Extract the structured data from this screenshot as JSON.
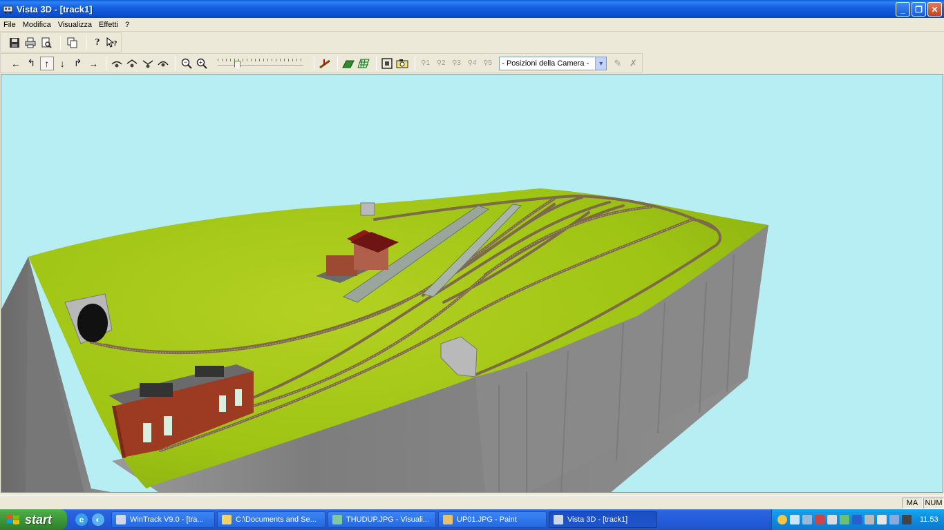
{
  "window": {
    "title": "Vista 3D - [track1]",
    "controls": {
      "minimize": "_",
      "maximize": "❐",
      "close": "✕"
    }
  },
  "menu": [
    "File",
    "Modifica",
    "Visualizza",
    "Effetti",
    "?"
  ],
  "toolbar1": {
    "icons": [
      "save-icon",
      "print-icon",
      "print-preview-icon",
      "copy-icon",
      "help-icon",
      "context-help-icon"
    ]
  },
  "toolbar2": {
    "nav_glyphs": {
      "left": "←",
      "turn_left": "↰",
      "up": "↑",
      "down": "↓",
      "turn_right": "↱",
      "right": "→"
    },
    "zoom_glyphs": {
      "out": "−",
      "in": "+"
    },
    "camera_labels": [
      "1",
      "2",
      "3",
      "4",
      "5"
    ],
    "camera_select_value": "- Posizioni della Camera -",
    "zoom_slider_value": 0.2
  },
  "status": {
    "ma": "MA",
    "num": "NUM"
  },
  "taskbar": {
    "start_label": "start",
    "tasks": [
      {
        "label": "WinTrack  V9.0 - [tra...",
        "active": false
      },
      {
        "label": "C:\\Documents and Se...",
        "active": false
      },
      {
        "label": "THUDUP.JPG - Visuali...",
        "active": false
      },
      {
        "label": "UP01.JPG - Paint",
        "active": false
      },
      {
        "label": "Vista 3D - [track1]",
        "active": true
      }
    ],
    "clock": "11.53"
  },
  "colors": {
    "sky": "#b6eef3",
    "grass": "#a8c81a",
    "cliff": "#8c8c8c",
    "brick": "#9c3a22",
    "xp_blue": "#245ddb"
  }
}
